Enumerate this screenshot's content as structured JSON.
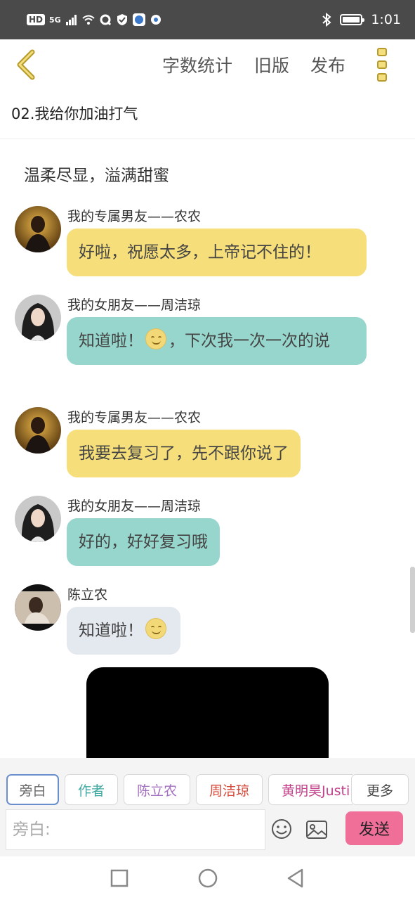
{
  "status_bar": {
    "hd": "HD",
    "signal_label": "5G",
    "time": "1:01"
  },
  "toolbar": {
    "word_count": "字数统计",
    "old_version": "旧版",
    "publish": "发布"
  },
  "chapter_title": "02.我给你加油打气",
  "subtitle": "温柔尽显，溢满甜蜜",
  "messages": [
    {
      "sender": "我的专属男友——农农",
      "text": "好啦，祝愿太多，上帝记不住的！",
      "color": "#f6de7b"
    },
    {
      "sender": "我的女朋友——周洁琼",
      "text_before": "知道啦！",
      "text_after": "，下次我一次一次的说",
      "color": "#97d6cc"
    },
    {
      "sender": "我的专属男友——农农",
      "text": "我要去复习了，先不跟你说了",
      "color": "#f6de7b"
    },
    {
      "sender": "我的女朋友——周洁琼",
      "text": "好的，好好复习哦",
      "color": "#97d6cc"
    },
    {
      "sender": "陈立农",
      "text": "知道啦！",
      "color": "#e4e8ef"
    }
  ],
  "roles": [
    {
      "label": "旁白",
      "color": "#666666"
    },
    {
      "label": "作者",
      "color": "#3fa8a3"
    },
    {
      "label": "陈立农",
      "color": "#a36fc0"
    },
    {
      "label": "周洁琼",
      "color": "#d6493a"
    },
    {
      "label": "黄明昊Justin",
      "color": "#c2418a"
    },
    {
      "label": "更多",
      "color": "#444444"
    }
  ],
  "input": {
    "placeholder": "旁白:",
    "send_label": "发送"
  },
  "colors": {
    "accent_yellow": "#f3df7e",
    "send_pink": "#ef6f99"
  }
}
